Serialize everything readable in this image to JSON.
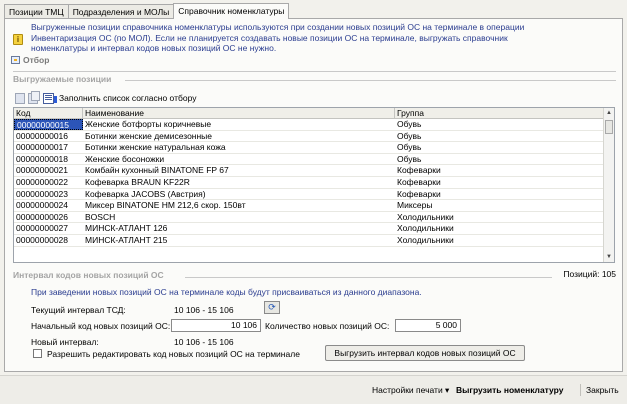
{
  "tabs": [
    "Позиции ТМЦ",
    "Подразделения и МОЛы",
    "Справочник номенклатуры"
  ],
  "info": {
    "text": "Выгруженные позиции справочника номенклатуры используются при создании новых позиций ОС на терминале в операции Инвентаризация ОС (по МОЛ). Если не планируется создавать новые позиции ОС на терминале, выгружать справочник номенклатуры и интервал кодов новых позиций ОС не нужно."
  },
  "filter_label": "Отбор",
  "positions": {
    "title": "Выгружаемые позиции",
    "fill_label": "Заполнить список согласно отбору",
    "columns": [
      "Код",
      "Наименование",
      "Группа"
    ],
    "rows": [
      [
        "00000000015",
        "Женские ботфорты коричневые",
        "Обувь"
      ],
      [
        "00000000016",
        "Ботинки женские демисезонные",
        "Обувь"
      ],
      [
        "00000000017",
        "Ботинки женские натуральная кожа",
        "Обувь"
      ],
      [
        "00000000018",
        "Женские босоножки",
        "Обувь"
      ],
      [
        "00000000021",
        "Комбайн кухонный BINATONE FP 67",
        "Кофеварки"
      ],
      [
        "00000000022",
        "Кофеварка BRAUN KF22R",
        "Кофеварки"
      ],
      [
        "00000000023",
        "Кофеварка JACOBS (Австрия)",
        "Кофеварки"
      ],
      [
        "00000000024",
        "Миксер BINATONE HM 212,6 скор. 150вт",
        "Миксеры"
      ],
      [
        "00000000026",
        "BOSCH",
        "Холодильники"
      ],
      [
        "00000000027",
        "МИНСК-АТЛАНТ 126",
        "Холодильники"
      ],
      [
        "00000000028",
        "МИНСК-АТЛАНТ 215",
        "Холодильники"
      ]
    ],
    "count": "Позиций: 105"
  },
  "interval": {
    "title": "Интервал кодов новых позиций ОС",
    "note": "При заведении новых позиций ОС на терминале коды будут присваиваться из данного диапазона.",
    "current_label": "Текущий интервал ТСД:",
    "current_value": "10 106 - 15 106",
    "start_label": "Начальный код новых позиций ОС:",
    "start_value": "10 106",
    "qty_label": "Количество новых позиций ОС:",
    "qty_value": "5 000",
    "new_label": "Новый интервал:",
    "new_value": "10 106 - 15 106",
    "allow_edit_label": "Разрешить редактировать код новых позиций ОС на терминале",
    "upload_button": "Выгрузить интервал кодов новых позиций ОС"
  },
  "footer": {
    "print_settings": "Настройки печати ▾",
    "upload_nomenclature": "Выгрузить номенклатуру",
    "close": "Закрыть"
  },
  "colors": {
    "info_text": "#2a3c8f",
    "selection": "#2c55b8",
    "background": "#f2f1ec"
  }
}
